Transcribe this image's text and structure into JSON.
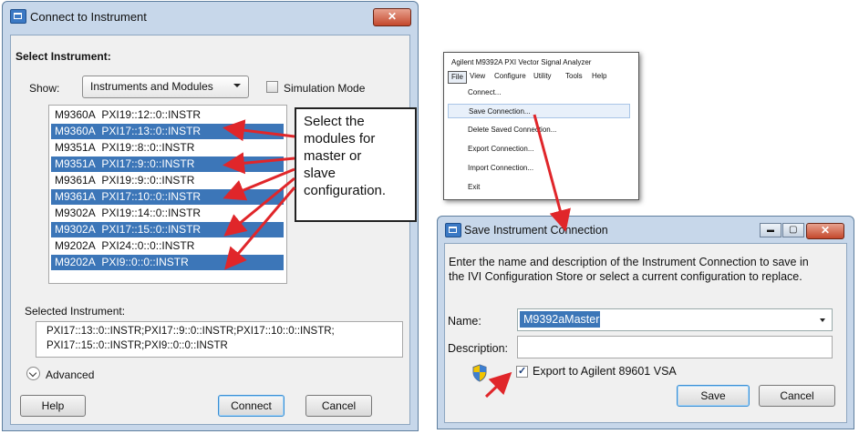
{
  "connect_dialog": {
    "title": "Connect to Instrument",
    "close_glyph": "✕",
    "section_label": "Select Instrument:",
    "show_label": "Show:",
    "show_value": "Instruments and Modules",
    "simulation_label": "Simulation Mode",
    "simulation_checked": false,
    "instruments": [
      {
        "model": "M9360A",
        "address": "PXI19::12::0::INSTR",
        "selected": false
      },
      {
        "model": "M9360A",
        "address": "PXI17::13::0::INSTR",
        "selected": true
      },
      {
        "model": "M9351A",
        "address": "PXI19::8::0::INSTR",
        "selected": false
      },
      {
        "model": "M9351A",
        "address": "PXI17::9::0::INSTR",
        "selected": true
      },
      {
        "model": "M9361A",
        "address": "PXI19::9::0::INSTR",
        "selected": false
      },
      {
        "model": "M9361A",
        "address": "PXI17::10::0::INSTR",
        "selected": true
      },
      {
        "model": "M9302A",
        "address": "PXI19::14::0::INSTR",
        "selected": false
      },
      {
        "model": "M9302A",
        "address": "PXI17::15::0::INSTR",
        "selected": true
      },
      {
        "model": "M9202A",
        "address": "PXI24::0::0::INSTR",
        "selected": false
      },
      {
        "model": "M9202A",
        "address": "PXI9::0::0::INSTR",
        "selected": true
      }
    ],
    "selected_label": "Selected Instrument:",
    "selected_line1": "PXI17::13::0::INSTR;PXI17::9::0::INSTR;PXI17::10::0::INSTR;",
    "selected_line2": "PXI17::15::0::INSTR;PXI9::0::0::INSTR",
    "advanced_label": "Advanced",
    "help_label": "Help",
    "connect_label": "Connect",
    "cancel_label": "Cancel"
  },
  "callout": {
    "lines": [
      "Select the",
      "modules for",
      "master or",
      "slave",
      "configuration."
    ]
  },
  "file_menu": {
    "app_title": "Agilent M9392A PXI Vector Signal Analyzer",
    "menubar": [
      "File",
      "View",
      "Configure",
      "Utility",
      "Tools",
      "Help"
    ],
    "active_menu": "File",
    "items": [
      "Connect...",
      "Save Connection...",
      "Delete Saved Connection...",
      "Export Connection...",
      "Import Connection...",
      "Exit"
    ],
    "highlighted_item": "Save Connection..."
  },
  "save_dialog": {
    "title": "Save Instrument Connection",
    "instructions_line1": "Enter the name and description of the Instrument Connection to save in",
    "instructions_line2": "the IVI Configuration Store or select a current configuration to replace.",
    "name_label": "Name:",
    "name_value": "M9392aMaster",
    "description_label": "Description:",
    "description_value": "",
    "export_label": "Export to Agilent 89601 VSA",
    "export_checked": true,
    "save_label": "Save",
    "cancel_label": "Cancel",
    "close_glyph": "✕",
    "minimize_glyph": "▬",
    "maximize_glyph": "▢"
  },
  "colors": {
    "selection": "#3c76b8",
    "arrow": "#e0262a",
    "title_bar": "#c7d7ea"
  }
}
